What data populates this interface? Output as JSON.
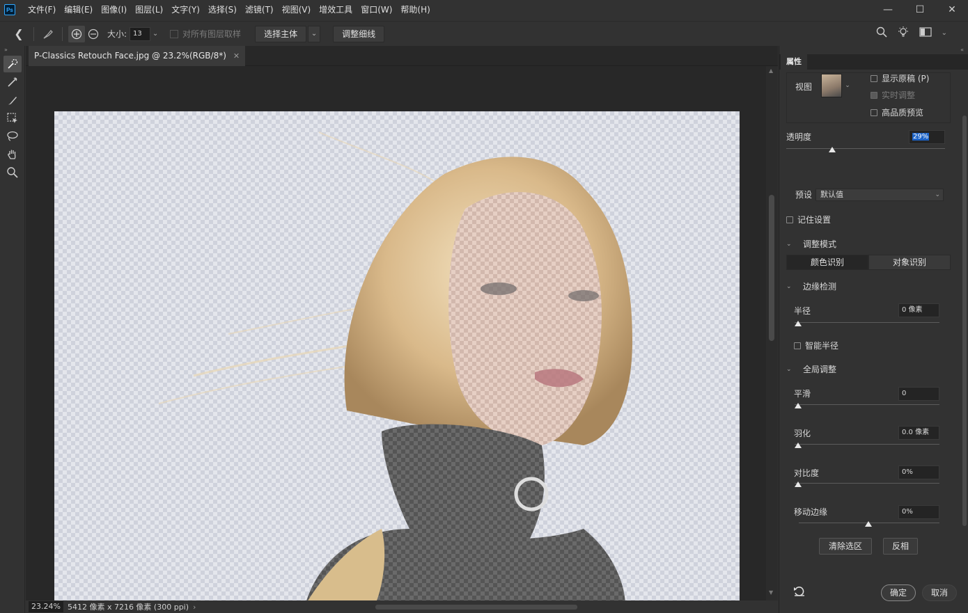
{
  "app": {
    "logo": "Ps"
  },
  "menu": [
    "文件(F)",
    "编辑(E)",
    "图像(I)",
    "图层(L)",
    "文字(Y)",
    "选择(S)",
    "滤镜(T)",
    "视图(V)",
    "增效工具",
    "窗口(W)",
    "帮助(H)"
  ],
  "options": {
    "size_label": "大小:",
    "size_value": "13",
    "sample_all_layers": "对所有图层取样",
    "select_subject": "选择主体",
    "refine_hair": "调整细线"
  },
  "document": {
    "tab_title": "P-Classics Retouch Face.jpg @ 23.2%(RGB/8*)",
    "zoom": "23.24%",
    "info": "5412 像素 x 7216 像素 (300 ppi)"
  },
  "panel": {
    "tab": "属性",
    "view_label": "视图",
    "show_original": "显示原稿 (P)",
    "realtime_adjust": "实时调整",
    "hq_preview": "高品质预览",
    "opacity_label": "透明度",
    "opacity_value": "29%",
    "opacity_level": 0.29,
    "preset_label": "预设",
    "preset_value": "默认值",
    "remember_settings": "记住设置",
    "adjust_mode": "调整模式",
    "color_aware": "颜色识别",
    "object_aware": "对象识别",
    "edge_detection": "边缘检测",
    "radius_label": "半径",
    "radius_value": "0 像素",
    "smart_radius": "智能半径",
    "global_refine": "全局调整",
    "smooth_label": "平滑",
    "smooth_value": "0",
    "feather_label": "羽化",
    "feather_value": "0.0 像素",
    "contrast_label": "对比度",
    "contrast_value": "0%",
    "shift_edge_label": "移动边缘",
    "shift_edge_value": "0%",
    "clear_selection": "清除选区",
    "invert": "反相",
    "ok": "确定",
    "cancel": "取消"
  },
  "colors": {
    "accent": "#31a8ff",
    "selection_highlight": "#1c63c7"
  }
}
